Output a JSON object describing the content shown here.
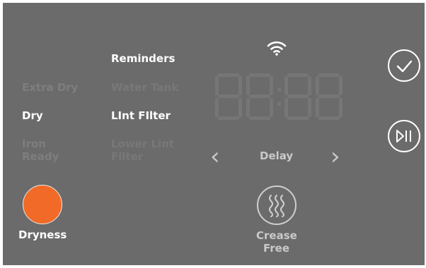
{
  "options_left": {
    "extra_dry": "Extra Dry",
    "dry": "Dry",
    "iron_ready_line1": "Iron",
    "iron_ready_line2": "Ready"
  },
  "options_right": {
    "reminders": "Reminders",
    "water_tank": "Water Tank",
    "lint_filter": "LInt FIlter",
    "lower_lint_line1": "Lower Lint",
    "lower_lint_line2": "Filter"
  },
  "display": {
    "time": "88:88"
  },
  "delay": {
    "label": "Delay",
    "prev_glyph": "‹",
    "next_glyph": "›"
  },
  "dryness": {
    "label": "Dryness",
    "indicator_color": "#f26a27"
  },
  "crease_free": {
    "label_line1": "Crease",
    "label_line2": "Free"
  },
  "icons": {
    "wifi": "wifi-icon",
    "confirm": "checkmark-icon",
    "start_pause": "play-pause-icon",
    "crease": "steam-waves-icon"
  }
}
